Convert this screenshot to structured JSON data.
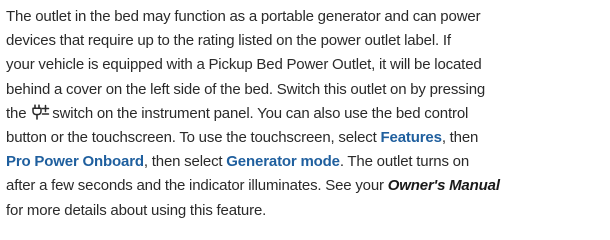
{
  "paragraph": {
    "line1": "The outlet in the bed may function as a portable generator and can power",
    "line2": "devices that require up to the rating listed on the power outlet label. If",
    "line3": "your vehicle is equipped with a Pickup Bed Power Outlet, it will be located",
    "line4": "behind a cover on the left side of the bed. Switch this outlet on by pressing",
    "line5_pre": "the",
    "line5_post": "switch on the instrument panel. You can also use the bed control",
    "line6_pre": "button or the touchscreen. To use the touchscreen, select",
    "features": "Features",
    "line6_post": ", then",
    "pro_power": "Pro Power Onboard",
    "line7_mid": ", then select",
    "generator_mode": "Generator mode",
    "line7_post": ". The outlet turns on",
    "line8_pre": "after a few seconds and the indicator illuminates. See your",
    "owners_manual": "Owner's Manual",
    "line9": "for more details about using this feature."
  },
  "icons": {
    "switch_icon": "power-outlet-switch-icon"
  }
}
